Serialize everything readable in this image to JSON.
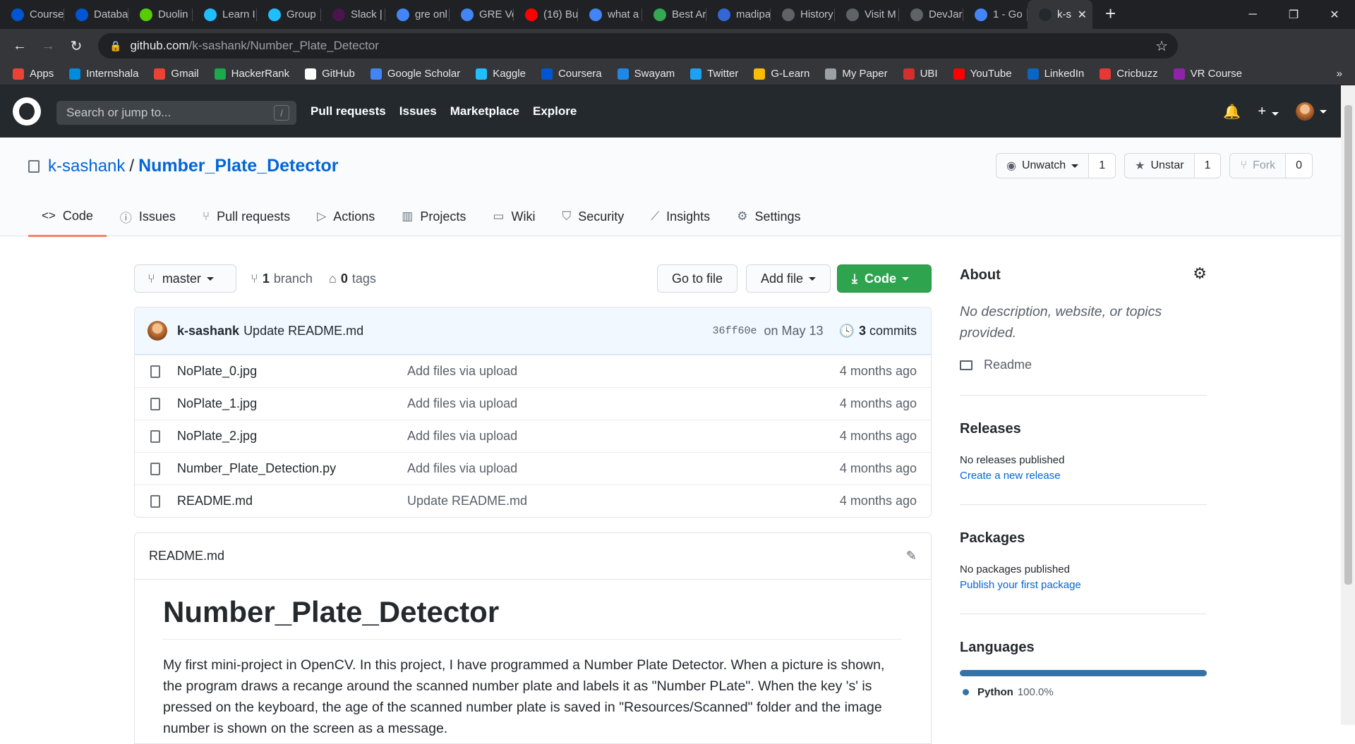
{
  "browser": {
    "tabs": [
      {
        "title": "Course",
        "icon": "coursera-icon",
        "color": "#0056d2"
      },
      {
        "title": "Databa",
        "icon": "coursera-icon",
        "color": "#0056d2"
      },
      {
        "title": "Duolin",
        "icon": "duolingo-icon",
        "color": "#58cc02"
      },
      {
        "title": "Learn I",
        "icon": "kaggle-k-icon",
        "color": "#20beff"
      },
      {
        "title": "Group",
        "icon": "kaggle-k-icon",
        "color": "#20beff"
      },
      {
        "title": "Slack |",
        "icon": "slack-icon",
        "color": "#4a154b"
      },
      {
        "title": "gre onl",
        "icon": "google-icon",
        "color": "#4285f4"
      },
      {
        "title": "GRE Ve",
        "icon": "google-icon",
        "color": "#4285f4"
      },
      {
        "title": "(16) Bu",
        "icon": "youtube-icon",
        "color": "#ff0000"
      },
      {
        "title": "what a",
        "icon": "google-icon",
        "color": "#4285f4"
      },
      {
        "title": "Best Ar",
        "icon": "site-icon",
        "color": "#34a853"
      },
      {
        "title": "madipa",
        "icon": "site-icon",
        "color": "#3367d6"
      },
      {
        "title": "History",
        "icon": "history-icon",
        "color": "#5f6368"
      },
      {
        "title": "Visit M",
        "icon": "globe-icon",
        "color": "#5f6368"
      },
      {
        "title": "DevJar",
        "icon": "globe-icon",
        "color": "#5f6368"
      },
      {
        "title": "1 - Go",
        "icon": "google-icon",
        "color": "#4285f4"
      },
      {
        "title": "k-s",
        "icon": "github-icon",
        "color": "#24292e",
        "active": true
      }
    ],
    "new_tab": "+",
    "window_controls": {
      "minimize": "─",
      "maximize": "❐",
      "close": "✕"
    },
    "url_host": "github.com",
    "url_path": "/k-sashank/Number_Plate_Detector",
    "bookmarks": [
      {
        "label": "Apps",
        "icon": "apps-grid-icon",
        "color": "#ea4335"
      },
      {
        "label": "Internshala",
        "icon": "internshala-icon",
        "color": "#008bdc"
      },
      {
        "label": "Gmail",
        "icon": "gmail-icon",
        "color": "#ea4335"
      },
      {
        "label": "HackerRank",
        "icon": "hackerrank-icon",
        "color": "#1ba94c"
      },
      {
        "label": "GitHub",
        "icon": "github-icon",
        "color": "#ffffff"
      },
      {
        "label": "Google Scholar",
        "icon": "scholar-icon",
        "color": "#4285f4"
      },
      {
        "label": "Kaggle",
        "icon": "kaggle-k-icon",
        "color": "#20beff"
      },
      {
        "label": "Coursera",
        "icon": "coursera-icon",
        "color": "#0056d2"
      },
      {
        "label": "Swayam",
        "icon": "swayam-icon",
        "color": "#1e88e5"
      },
      {
        "label": "Twitter",
        "icon": "twitter-icon",
        "color": "#1da1f2"
      },
      {
        "label": "G-Learn",
        "icon": "glearn-icon",
        "color": "#fbbc05"
      },
      {
        "label": "My Paper",
        "icon": "globe-icon",
        "color": "#9aa0a6"
      },
      {
        "label": "UBI",
        "icon": "ubi-icon",
        "color": "#d32f2f"
      },
      {
        "label": "YouTube",
        "icon": "youtube-icon",
        "color": "#ff0000"
      },
      {
        "label": "LinkedIn",
        "icon": "linkedin-icon",
        "color": "#0a66c2"
      },
      {
        "label": "Cricbuzz",
        "icon": "cricbuzz-icon",
        "color": "#e53935"
      },
      {
        "label": "VR Course",
        "icon": "vr-icon",
        "color": "#8e24aa"
      }
    ],
    "bookmarks_more": "»"
  },
  "github": {
    "search_placeholder": "Search or jump to...",
    "search_shortcut": "/",
    "nav": [
      "Pull requests",
      "Issues",
      "Marketplace",
      "Explore"
    ]
  },
  "repo": {
    "owner": "k-sashank",
    "separator": "/",
    "name": "Number_Plate_Detector",
    "watch": {
      "label": "Unwatch",
      "count": "1"
    },
    "star": {
      "label": "Unstar",
      "count": "1"
    },
    "fork": {
      "label": "Fork",
      "count": "0"
    },
    "tabs": [
      {
        "label": "Code",
        "icon": "<>",
        "selected": true
      },
      {
        "label": "Issues",
        "icon": "ⓘ"
      },
      {
        "label": "Pull requests",
        "icon": "⑂"
      },
      {
        "label": "Actions",
        "icon": "▷"
      },
      {
        "label": "Projects",
        "icon": "▥"
      },
      {
        "label": "Wiki",
        "icon": "▭"
      },
      {
        "label": "Security",
        "icon": "⛉"
      },
      {
        "label": "Insights",
        "icon": "⟋"
      },
      {
        "label": "Settings",
        "icon": "⚙"
      }
    ]
  },
  "code": {
    "branch": "master",
    "branches_count": "1",
    "branches_label": "branch",
    "tags_count": "0",
    "tags_label": "tags",
    "go_to_file": "Go to file",
    "add_file": "Add file",
    "code_button": "Code",
    "commit": {
      "author": "k-sashank",
      "message": "Update README.md",
      "sha": "36ff60e",
      "date": "on May 13",
      "commits_count": "3",
      "commits_label": "commits"
    },
    "files": [
      {
        "name": "NoPlate_0.jpg",
        "message": "Add files via upload",
        "age": "4 months ago"
      },
      {
        "name": "NoPlate_1.jpg",
        "message": "Add files via upload",
        "age": "4 months ago"
      },
      {
        "name": "NoPlate_2.jpg",
        "message": "Add files via upload",
        "age": "4 months ago"
      },
      {
        "name": "Number_Plate_Detection.py",
        "message": "Add files via upload",
        "age": "4 months ago"
      },
      {
        "name": "README.md",
        "message": "Update README.md",
        "age": "4 months ago"
      }
    ]
  },
  "readme": {
    "filename": "README.md",
    "heading": "Number_Plate_Detector",
    "body": "My first mini-project in OpenCV. In this project, I have programmed a Number Plate Detector. When a picture is shown, the program draws a recange around the scanned number plate and labels it as \"Number PLate\". When the key 's' is pressed on the keyboard, the age of the scanned number plate is saved in \"Resources/Scanned\" folder and the image number is shown on the screen as a message."
  },
  "sidebar": {
    "about_title": "About",
    "about_desc": "No description, website, or topics provided.",
    "readme_link": "Readme",
    "releases_title": "Releases",
    "releases_none": "No releases published",
    "releases_create": "Create a new release",
    "packages_title": "Packages",
    "packages_none": "No packages published",
    "packages_publish": "Publish your first package",
    "languages_title": "Languages",
    "language_name": "Python",
    "language_pct": "100.0%",
    "language_color": "#3572a5"
  }
}
